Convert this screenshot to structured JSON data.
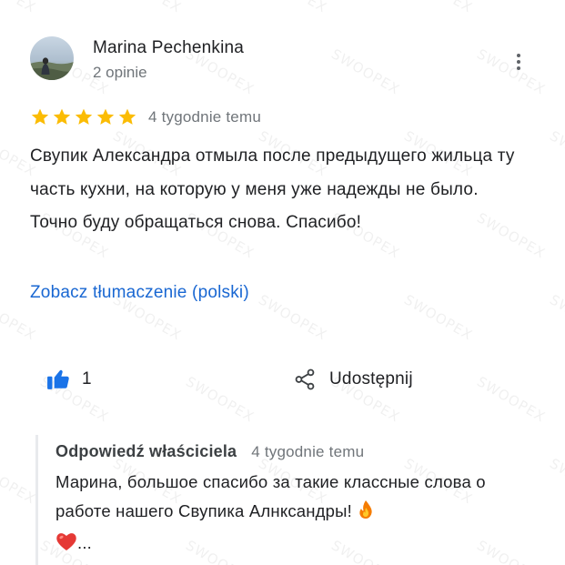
{
  "watermark": "SWOOPEX",
  "review": {
    "author_name": "Marina Pechenkina",
    "author_meta": "2 opinie",
    "rating": 5,
    "rating_max": 5,
    "date": "4 tygodnie temu",
    "text": "Свупик Александра отмыла после предыдущего жильца ту часть кухни, на которую у меня уже надежды не было. Точно буду обращаться снова. Спасибо!",
    "translate_label": "Zobacz tłumaczenie (polski)"
  },
  "actions": {
    "like_count": "1",
    "share_label": "Udostępnij"
  },
  "owner_reply": {
    "title": "Odpowiedź właściciela",
    "date": "4 tygodnie temu",
    "text": "Марина, большое спасибо за такие классные слова о работе нашего Свупика Алнксандры!",
    "ellipsis": "..."
  },
  "icons": {
    "avatar": "user-avatar-photo",
    "more": "more-vert-icon",
    "star": "star-icon",
    "like": "thumb-up-icon",
    "share": "share-icon",
    "fire": "fire-emoji",
    "heart": "heart-emoji"
  },
  "colors": {
    "star": "#fbbc04",
    "link": "#1967d2",
    "thumb": "#1a73e8",
    "heart": "#e53935",
    "muted_text": "#70757a"
  }
}
